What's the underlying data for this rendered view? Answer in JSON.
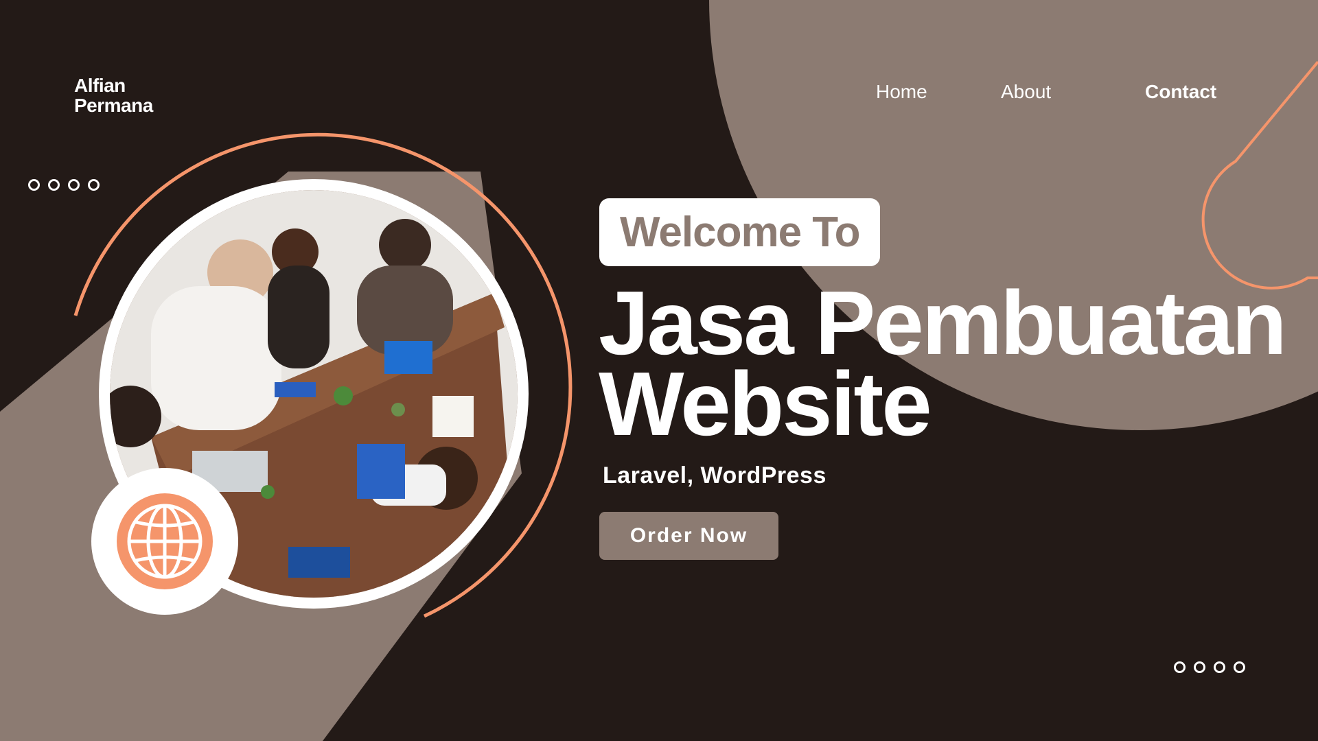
{
  "brand": {
    "line1": "Alfian",
    "line2": "Permana"
  },
  "nav": {
    "home": "Home",
    "about": "About",
    "contact": "Contact"
  },
  "hero": {
    "welcome": "Welcome To",
    "title_line1": "Jasa Pembuatan",
    "title_line2": "Website",
    "subtitle": "Laravel, WordPress",
    "cta": "Order Now"
  },
  "images": {
    "team_photo": "team-meeting-handshake-photo",
    "badge_icon": "globe-icon"
  },
  "colors": {
    "background": "#231a17",
    "taupe": "#8c7b72",
    "accent_orange": "#f5956b",
    "white": "#ffffff"
  }
}
